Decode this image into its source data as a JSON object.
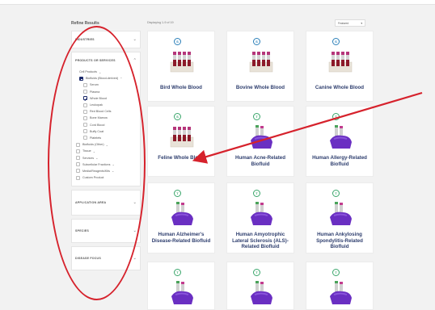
{
  "refine_label": "Refine Results",
  "filters": {
    "industries": {
      "label": "INDUSTRIES"
    },
    "products": {
      "label": "PRODUCTS OR SERVICES"
    },
    "application": {
      "label": "APPLICATION AREA"
    },
    "species": {
      "label": "SPECIES"
    },
    "disease": {
      "label": "DISEASE FOCUS"
    }
  },
  "product_options": [
    {
      "label": "Cell Products",
      "level": 1,
      "checked": "none",
      "chevron": true
    },
    {
      "label": "Biofluids (Blood-derived)",
      "level": 1,
      "checked": "partial",
      "chevron": true
    },
    {
      "label": "Serum",
      "level": 2,
      "checked": "none"
    },
    {
      "label": "Plasma",
      "level": 2,
      "checked": "none"
    },
    {
      "label": "Whole Blood",
      "level": 2,
      "checked": "checked"
    },
    {
      "label": "Leukopak",
      "level": 2,
      "checked": "none"
    },
    {
      "label": "Red Blood Cells",
      "level": 2,
      "checked": "none"
    },
    {
      "label": "Bone Marrow",
      "level": 2,
      "checked": "none"
    },
    {
      "label": "Cord Blood",
      "level": 2,
      "checked": "none"
    },
    {
      "label": "Buffy Coat",
      "level": 2,
      "checked": "none"
    },
    {
      "label": "Platelets",
      "level": 2,
      "checked": "none"
    },
    {
      "label": "Biofluids (Other)",
      "level": 0,
      "checked": "none",
      "chevron": true
    },
    {
      "label": "Tissue",
      "level": 0,
      "checked": "none",
      "chevron": true
    },
    {
      "label": "Services",
      "level": 0,
      "checked": "none",
      "chevron": true
    },
    {
      "label": "Subcellular Fractions",
      "level": 0,
      "checked": "none",
      "chevron": true
    },
    {
      "label": "Media/Reagents/Kits",
      "level": 0,
      "checked": "none",
      "chevron": true
    },
    {
      "label": "Custom Product",
      "level": 0,
      "checked": "none"
    }
  ],
  "showing_text": "Displaying 1-9 of 19",
  "sort": {
    "label": "Featured"
  },
  "products": [
    {
      "name": "Bird Whole Blood",
      "badge": "S",
      "badge_color": "blue",
      "image": "tubes-rack"
    },
    {
      "name": "Bovine Whole Blood",
      "badge": "S",
      "badge_color": "blue",
      "image": "tubes-rack"
    },
    {
      "name": "Canine Whole Blood",
      "badge": "S",
      "badge_color": "blue",
      "image": "tubes-rack"
    },
    {
      "name": "Feline Whole Blood",
      "badge": "S",
      "badge_color": "green",
      "image": "tubes-rack"
    },
    {
      "name": "Human Acne-Related Biofluid",
      "badge": "T",
      "badge_color": "green",
      "image": "gloved-hand-tubes"
    },
    {
      "name": "Human Allergy-Related Biofluid",
      "badge": "T",
      "badge_color": "green",
      "image": "gloved-hand-tubes"
    },
    {
      "name": "Human Alzheimer's Disease-Related Biofluid",
      "badge": "T",
      "badge_color": "green",
      "image": "gloved-hand-tubes"
    },
    {
      "name": "Human Amyotrophic Lateral Sclerosis (ALS)-Related Biofluid",
      "badge": "T",
      "badge_color": "green",
      "image": "gloved-hand-tubes"
    },
    {
      "name": "Human Ankylosing Spondylitis-Related Biofluid",
      "badge": "T",
      "badge_color": "green",
      "image": "gloved-hand-tubes"
    },
    {
      "name": "",
      "badge": "T",
      "badge_color": "green",
      "image": "gloved-hand-tubes"
    },
    {
      "name": "",
      "badge": "T",
      "badge_color": "green",
      "image": "gloved-hand-tubes"
    },
    {
      "name": "",
      "badge": "T",
      "badge_color": "green",
      "image": "gloved-hand-tubes"
    }
  ],
  "annotation_color": "#d6222c",
  "brand_color": "#2e3e6e"
}
